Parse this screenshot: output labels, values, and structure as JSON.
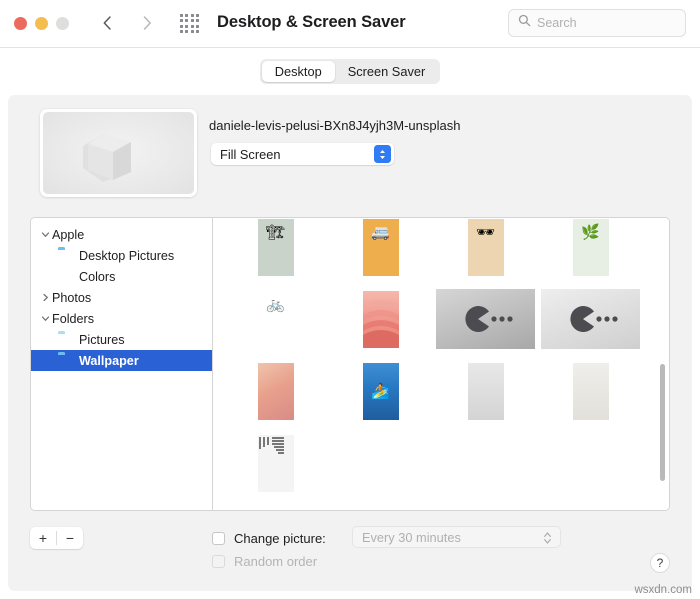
{
  "window": {
    "title": "Desktop & Screen Saver",
    "traffic_lights": [
      {
        "name": "close",
        "color": "#ec6a5e"
      },
      {
        "name": "minimize",
        "color": "#f3be4f"
      },
      {
        "name": "zoom",
        "color": "#dededd"
      }
    ],
    "nav": {
      "back_icon": "chevron-left-icon",
      "forward_icon": "chevron-right-icon"
    },
    "grid_button_icon": "grid-apps-icon"
  },
  "search": {
    "placeholder": "Search",
    "value": "",
    "icon": "search-icon"
  },
  "tabs": [
    {
      "label": "Desktop",
      "active": true
    },
    {
      "label": "Screen Saver",
      "active": false
    }
  ],
  "preview": {
    "filename": "daniele-levis-pelusi-BXn8J4yjh3M-unsplash",
    "fit_mode": "Fill Screen",
    "fit_arrow_icon": "chevron-up-down-icon",
    "accent_color": "#2f7cf6"
  },
  "sidebar": {
    "items": [
      {
        "label": "Apple",
        "level": 0,
        "disclosure": "expanded",
        "icon": "none",
        "selected": false
      },
      {
        "label": "Desktop Pictures",
        "level": 1,
        "disclosure": "none",
        "icon": "folder-icon",
        "selected": false
      },
      {
        "label": "Colors",
        "level": 1,
        "disclosure": "none",
        "icon": "color-wheel-icon",
        "selected": false
      },
      {
        "label": "Photos",
        "level": 0,
        "disclosure": "collapsed",
        "icon": "none",
        "selected": false
      },
      {
        "label": "Folders",
        "level": 0,
        "disclosure": "expanded",
        "icon": "none",
        "selected": false
      },
      {
        "label": "Pictures",
        "level": 1,
        "disclosure": "none",
        "icon": "folder-icon-faded",
        "selected": false
      },
      {
        "label": "Wallpaper",
        "level": 1,
        "disclosure": "none",
        "icon": "folder-icon",
        "selected": true
      }
    ],
    "selection_color": "#2a62d6"
  },
  "thumbnails": [
    {
      "name": "crane-wallpaper",
      "orientation": "portrait",
      "bg": "#c9d3c9",
      "emoji": "🏗",
      "empty": false
    },
    {
      "name": "van-wallpaper",
      "orientation": "portrait",
      "bg": "#efae4e",
      "emoji": "🚐",
      "empty": false
    },
    {
      "name": "sunglasses-wallpaper",
      "orientation": "portrait",
      "bg": "#ecd5b0",
      "emoji": "🕶",
      "empty": false
    },
    {
      "name": "plant-wallpaper",
      "orientation": "portrait",
      "bg": "#e7efe5",
      "emoji": "🌿",
      "empty": false
    },
    {
      "name": "bicycle-wallpaper",
      "orientation": "portrait",
      "bg": "#ffffff",
      "emoji": "🚲",
      "empty": false
    },
    {
      "name": "pink-waves-wallpaper",
      "orientation": "portrait",
      "bg": "#e8796f",
      "emoji": "",
      "empty": false
    },
    {
      "name": "pacman-gray-wallpaper",
      "orientation": "landscape",
      "bg": "#b9b9b9",
      "emoji": "",
      "empty": false
    },
    {
      "name": "pacman-light-wallpaper",
      "orientation": "landscape",
      "bg": "#dcdcdc",
      "emoji": "",
      "empty": false
    },
    {
      "name": "peach-gradient-wallpaper",
      "orientation": "portrait",
      "bg": "#e7a18c",
      "emoji": "",
      "empty": false
    },
    {
      "name": "surfer-wave-wallpaper",
      "orientation": "portrait",
      "bg": "#2a79c4",
      "emoji": "🏄",
      "empty": false
    },
    {
      "name": "gray-gradient-wallpaper",
      "orientation": "portrait",
      "bg": "#dedede",
      "emoji": "",
      "empty": false
    },
    {
      "name": "beige-gradient-wallpaper",
      "orientation": "portrait",
      "bg": "#e6e4df",
      "emoji": "",
      "empty": false
    },
    {
      "name": "lines-pattern-wallpaper",
      "orientation": "portrait",
      "bg": "#f4f4f4",
      "emoji": "",
      "empty": false
    }
  ],
  "bottom": {
    "add_label": "+",
    "remove_label": "−",
    "change_picture_label": "Change picture:",
    "change_picture_checked": false,
    "interval_value": "Every 30 minutes",
    "interval_enabled": false,
    "random_order_label": "Random order",
    "random_order_checked": false,
    "random_order_enabled": false,
    "help_label": "?"
  },
  "watermark": "wsxdn.com"
}
